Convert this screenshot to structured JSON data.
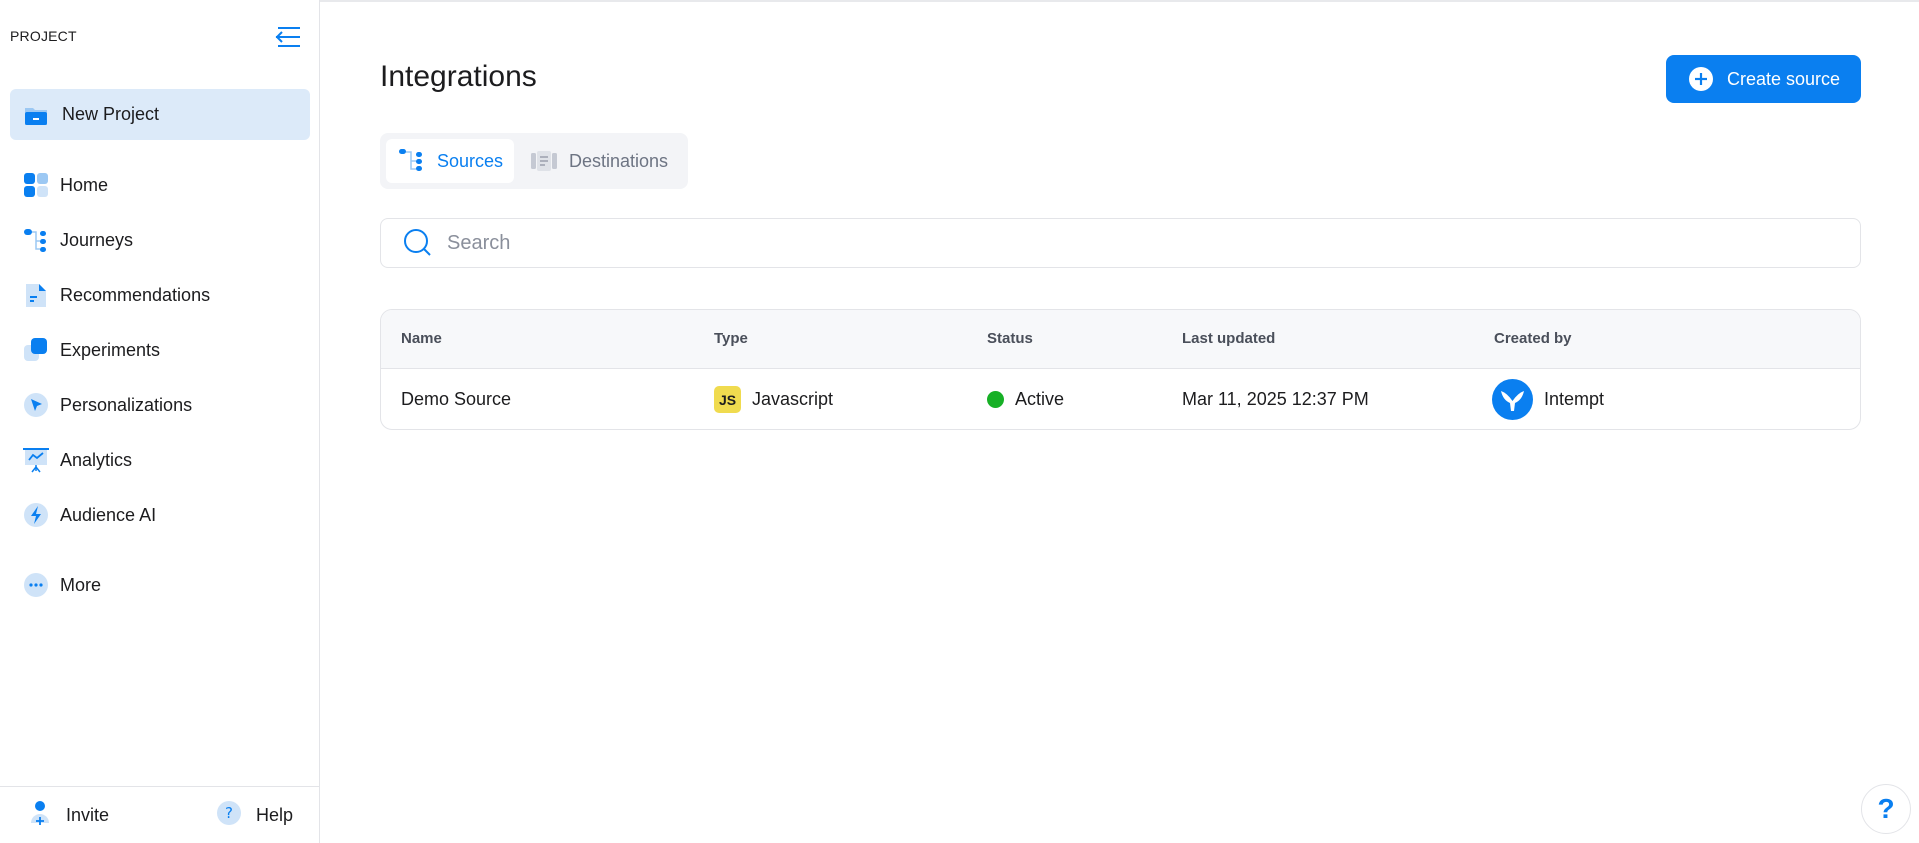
{
  "sidebar": {
    "section_label": "PROJECT",
    "project": {
      "label": "New Project",
      "icon": "folder-icon"
    },
    "items": [
      {
        "label": "Home",
        "icon": "home-grid-icon"
      },
      {
        "label": "Journeys",
        "icon": "journeys-icon"
      },
      {
        "label": "Recommendations",
        "icon": "document-icon"
      },
      {
        "label": "Experiments",
        "icon": "experiments-icon"
      },
      {
        "label": "Personalizations",
        "icon": "cursor-icon"
      },
      {
        "label": "Analytics",
        "icon": "presentation-chart-icon"
      },
      {
        "label": "Audience AI",
        "icon": "lightning-icon"
      },
      {
        "label": "More",
        "icon": "more-dots-icon"
      }
    ],
    "footer": {
      "invite_label": "Invite",
      "help_label": "Help"
    }
  },
  "main": {
    "title": "Integrations",
    "create_button_label": "Create source",
    "tabs": [
      {
        "label": "Sources",
        "active": true
      },
      {
        "label": "Destinations",
        "active": false
      }
    ],
    "search": {
      "placeholder": "Search",
      "value": ""
    },
    "table": {
      "columns": [
        "Name",
        "Type",
        "Status",
        "Last updated",
        "Created by"
      ],
      "rows": [
        {
          "name": "Demo Source",
          "type_badge": "JS",
          "type": "Javascript",
          "status": "Active",
          "last_updated": "Mar 11, 2025 12:37 PM",
          "created_by": "Intempt"
        }
      ]
    }
  },
  "help_fab_label": "?",
  "colors": {
    "accent": "#0a7ff0",
    "active_bg": "#dceaf9",
    "status_active": "#17b026",
    "js_badge": "#f0db4f"
  }
}
